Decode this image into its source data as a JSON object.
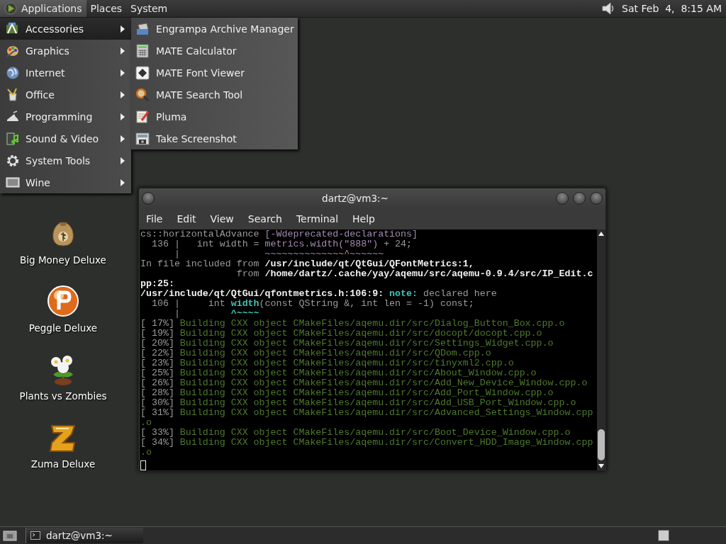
{
  "top_panel": {
    "menus": [
      {
        "label": "Applications",
        "selected": true
      },
      {
        "label": "Places",
        "selected": false
      },
      {
        "label": "System",
        "selected": false
      }
    ],
    "clock": "Sat Feb  4,  8:15 AM"
  },
  "applications_menu": {
    "items": [
      {
        "label": "Accessories",
        "selected": true
      },
      {
        "label": "Graphics",
        "selected": false
      },
      {
        "label": "Internet",
        "selected": false
      },
      {
        "label": "Office",
        "selected": false
      },
      {
        "label": "Programming",
        "selected": false
      },
      {
        "label": "Sound & Video",
        "selected": false
      },
      {
        "label": "System Tools",
        "selected": false
      },
      {
        "label": "Wine",
        "selected": false
      }
    ]
  },
  "accessories_submenu": {
    "items": [
      {
        "label": "Engrampa Archive Manager"
      },
      {
        "label": "MATE Calculator"
      },
      {
        "label": "MATE Font Viewer"
      },
      {
        "label": "MATE Search Tool"
      },
      {
        "label": "Pluma"
      },
      {
        "label": "Take Screenshot"
      }
    ]
  },
  "desktop_icons": [
    {
      "label": "Big Money Deluxe"
    },
    {
      "label": "Peggle Deluxe"
    },
    {
      "label": "Plants vs Zombies"
    },
    {
      "label": "Zuma Deluxe"
    }
  ],
  "terminal": {
    "title": "dartz@vm3:~",
    "menu": [
      "File",
      "Edit",
      "View",
      "Search",
      "Terminal",
      "Help"
    ],
    "lines": [
      [
        {
          "kind": "plain",
          "text": "cs::horizontalAdvance "
        },
        {
          "kind": "warn",
          "text": "[-Wdeprecated-declarations]"
        }
      ],
      [
        {
          "kind": "plain",
          "text": "  136 |   int width = "
        },
        {
          "kind": "warn",
          "text": "metrics.width(\"888\")"
        },
        {
          "kind": "plain",
          "text": " + 24;"
        }
      ],
      [
        {
          "kind": "plain",
          "text": "      |               "
        },
        {
          "kind": "warn",
          "text": "~~~~~~~~~~~~~~^~~~~~~"
        }
      ],
      [
        {
          "kind": "plain",
          "text": "In file included from "
        },
        {
          "kind": "bold",
          "text": "/usr/include/qt/QtGui/QFontMetrics:1,"
        }
      ],
      [
        {
          "kind": "plain",
          "text": "                 from "
        },
        {
          "kind": "bold",
          "text": "/home/dartz/.cache/yay/aqemu/src/aqemu-0.9.4/src/IP_Edit.c"
        }
      ],
      [
        {
          "kind": "bold",
          "text": "pp:25:"
        }
      ],
      [
        {
          "kind": "bold",
          "text": "/usr/include/qt/QtGui/qfontmetrics.h:106:9:"
        },
        {
          "kind": "note",
          "text": " note:"
        },
        {
          "kind": "plain",
          "text": " declared here"
        }
      ],
      [
        {
          "kind": "plain",
          "text": "  106 |     int "
        },
        {
          "kind": "note",
          "text": "width"
        },
        {
          "kind": "plain",
          "text": "(const QString &, int len = -1) const;"
        }
      ],
      [
        {
          "kind": "plain",
          "text": "      |         "
        },
        {
          "kind": "note",
          "text": "^~~~~"
        }
      ],
      [
        {
          "kind": "plain",
          "text": "[ 17%] "
        },
        {
          "kind": "green",
          "text": "Building CXX object CMakeFiles/aqemu.dir/src/Dialog_Button_Box.cpp.o"
        }
      ],
      [
        {
          "kind": "plain",
          "text": "[ 19%] "
        },
        {
          "kind": "green",
          "text": "Building CXX object CMakeFiles/aqemu.dir/src/docopt/docopt.cpp.o"
        }
      ],
      [
        {
          "kind": "plain",
          "text": "[ 20%] "
        },
        {
          "kind": "green",
          "text": "Building CXX object CMakeFiles/aqemu.dir/src/Settings_Widget.cpp.o"
        }
      ],
      [
        {
          "kind": "plain",
          "text": "[ 22%] "
        },
        {
          "kind": "green",
          "text": "Building CXX object CMakeFiles/aqemu.dir/src/QDom.cpp.o"
        }
      ],
      [
        {
          "kind": "plain",
          "text": "[ 23%] "
        },
        {
          "kind": "green",
          "text": "Building CXX object CMakeFiles/aqemu.dir/src/tinyxml2.cpp.o"
        }
      ],
      [
        {
          "kind": "plain",
          "text": "[ 25%] "
        },
        {
          "kind": "green",
          "text": "Building CXX object CMakeFiles/aqemu.dir/src/About_Window.cpp.o"
        }
      ],
      [
        {
          "kind": "plain",
          "text": "[ 26%] "
        },
        {
          "kind": "green",
          "text": "Building CXX object CMakeFiles/aqemu.dir/src/Add_New_Device_Window.cpp.o"
        }
      ],
      [
        {
          "kind": "plain",
          "text": "[ 28%] "
        },
        {
          "kind": "green",
          "text": "Building CXX object CMakeFiles/aqemu.dir/src/Add_Port_Window.cpp.o"
        }
      ],
      [
        {
          "kind": "plain",
          "text": "[ 30%] "
        },
        {
          "kind": "green",
          "text": "Building CXX object CMakeFiles/aqemu.dir/src/Add_USB_Port_Window.cpp.o"
        }
      ],
      [
        {
          "kind": "plain",
          "text": "[ 31%] "
        },
        {
          "kind": "green",
          "text": "Building CXX object CMakeFiles/aqemu.dir/src/Advanced_Settings_Window.cpp"
        }
      ],
      [
        {
          "kind": "green",
          "text": ".o"
        }
      ],
      [
        {
          "kind": "plain",
          "text": "[ 33%] "
        },
        {
          "kind": "green",
          "text": "Building CXX object CMakeFiles/aqemu.dir/src/Boot_Device_Window.cpp.o"
        }
      ],
      [
        {
          "kind": "plain",
          "text": "[ 34%] "
        },
        {
          "kind": "green",
          "text": "Building CXX object CMakeFiles/aqemu.dir/src/Convert_HDD_Image_Window.cpp"
        }
      ],
      [
        {
          "kind": "green",
          "text": ".o"
        }
      ]
    ]
  },
  "taskbar": {
    "tasks": [
      {
        "label": "dartz@vm3:~",
        "selected": true
      }
    ]
  }
}
